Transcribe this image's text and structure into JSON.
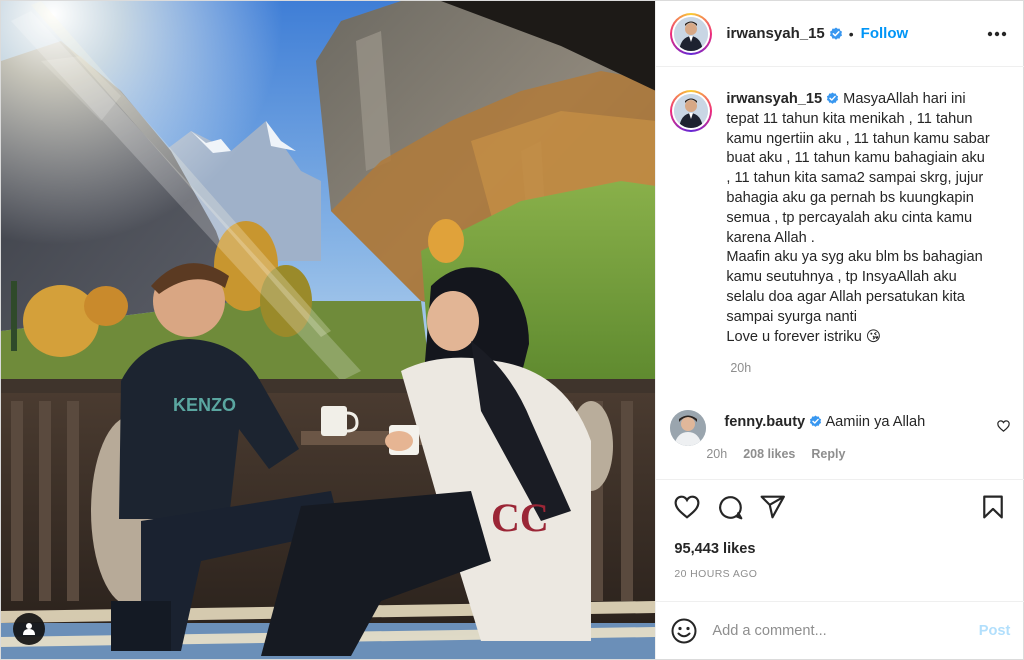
{
  "post": {
    "author": {
      "username": "irwansyah_15",
      "verified": true,
      "avatar_icon": "profile-photo-man-in-suit",
      "follow_label": "Follow",
      "separator": "•"
    },
    "caption": {
      "lines": [
        "MasyaAllah hari ini",
        "tepat 11 tahun kita menikah , 11 tahun",
        "kamu ngertiin aku , 11 tahun kamu sabar",
        "buat aku , 11 tahun kamu bahagiain aku",
        ", 11 tahun kita sama2 sampai skrg, jujur",
        "bahagia aku ga pernah bs kuungkapin",
        "semua , tp percayalah aku cinta kamu",
        "karena Allah .",
        "Maafin aku ya syg aku blm bs bahagian",
        "kamu seutuhnya , tp InsyaAllah aku",
        "selalu doa agar Allah persatukan kita",
        "sampai syurga nanti",
        "Love u forever istriku 😘"
      ],
      "time": "20h"
    },
    "comments": [
      {
        "username": "fenny.bauty",
        "verified": true,
        "text": "Aamiin ya Allah",
        "time": "20h",
        "likes": "208 likes",
        "reply_label": "Reply"
      }
    ],
    "likes_count": "95,443 likes",
    "time_ago": "20 HOURS AGO",
    "add_comment": {
      "placeholder": "Add a comment...",
      "post_label": "Post"
    }
  },
  "photo": {
    "description_icon": "couple-on-balcony-mountain-valley",
    "tag_icon": "user-tag-icon"
  },
  "colors": {
    "accent_blue": "#0095f6",
    "post_disabled": "#b2dffc",
    "secondary_text": "#8e8e8e",
    "primary_text": "#262626"
  }
}
